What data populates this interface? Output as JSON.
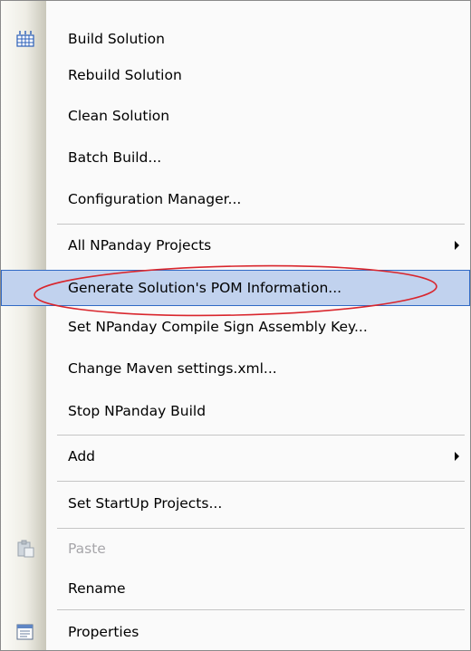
{
  "menu": {
    "items": [
      {
        "label": "Build Solution",
        "icon": "build-icon"
      },
      {
        "label": "Rebuild Solution"
      },
      {
        "label": "Clean Solution"
      },
      {
        "label": "Batch Build..."
      },
      {
        "label": "Configuration Manager..."
      },
      {
        "label": "All NPanday Projects",
        "submenu": true
      },
      {
        "label": "Generate Solution's POM Information...",
        "highlighted": true
      },
      {
        "label": "Set NPanday Compile Sign Assembly Key..."
      },
      {
        "label": "Change Maven settings.xml..."
      },
      {
        "label": "Stop NPanday Build"
      },
      {
        "label": "Add",
        "submenu": true
      },
      {
        "label": "Set StartUp Projects..."
      },
      {
        "label": "Paste",
        "disabled": true,
        "icon": "paste-icon"
      },
      {
        "label": "Rename"
      },
      {
        "label": "Properties",
        "icon": "properties-icon"
      }
    ]
  },
  "colors": {
    "highlight_bg": "#c1d2ee",
    "highlight_border": "#316ac5",
    "annotation_oval": "#d9262d",
    "disabled_text": "#a7a6aa"
  }
}
